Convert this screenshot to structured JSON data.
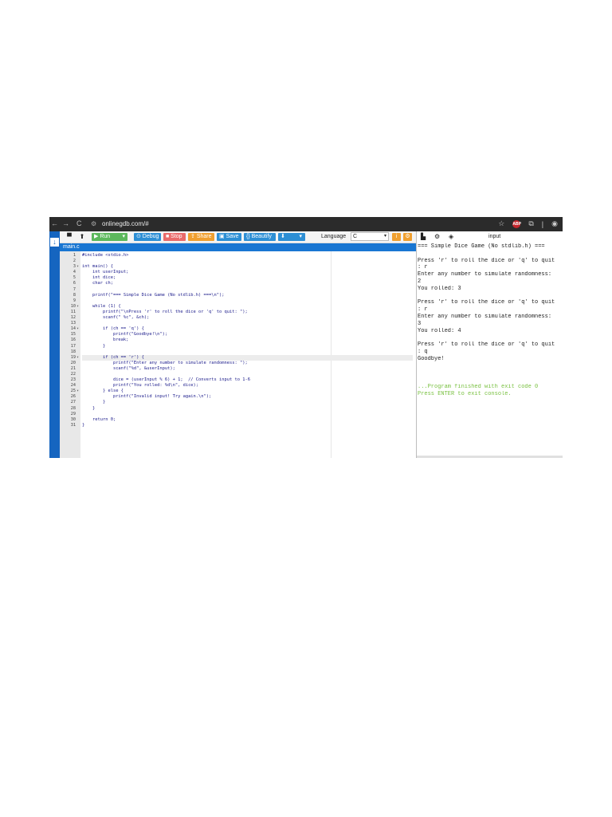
{
  "browser": {
    "url": "onlinegdb.com/#",
    "nav_back": "←",
    "nav_forward": "→",
    "reload": "C",
    "abp_label": "ABP"
  },
  "toolbar": {
    "run_label": "▶ Run",
    "debug_label": "⊙ Debug",
    "stop_label": "■ Stop",
    "share_label": "Share",
    "save_label": "Save",
    "beautify_label": "{} Beautify",
    "language_label": "Language",
    "language_value": "C",
    "colors": {
      "run": "#5cb85c",
      "debug": "#2d8fd5",
      "stop": "#e96a6a",
      "share": "#f0a030",
      "save": "#2d8fd5",
      "beautify": "#2d8fd5"
    }
  },
  "file_tab": {
    "name": "main.c"
  },
  "editor": {
    "lines": [
      {
        "n": "1",
        "text": "#include <stdio.h>"
      },
      {
        "n": "2",
        "text": ""
      },
      {
        "n": "3",
        "text": "int main() {"
      },
      {
        "n": "4",
        "text": "    int userInput;"
      },
      {
        "n": "5",
        "text": "    int dice;"
      },
      {
        "n": "6",
        "text": "    char ch;"
      },
      {
        "n": "7",
        "text": ""
      },
      {
        "n": "8",
        "text": "    printf(\"=== Simple Dice Game (No stdlib.h) ===\\n\");"
      },
      {
        "n": "9",
        "text": ""
      },
      {
        "n": "10",
        "text": "    while (1) {"
      },
      {
        "n": "11",
        "text": "        printf(\"\\nPress 'r' to roll the dice or 'q' to quit: \");"
      },
      {
        "n": "12",
        "text": "        scanf(\" %c\", &ch);"
      },
      {
        "n": "13",
        "text": ""
      },
      {
        "n": "14",
        "text": "        if (ch == 'q') {"
      },
      {
        "n": "15",
        "text": "            printf(\"Goodbye!\\n\");"
      },
      {
        "n": "16",
        "text": "            break;"
      },
      {
        "n": "17",
        "text": "        }"
      },
      {
        "n": "18",
        "text": ""
      },
      {
        "n": "19",
        "text": "        if (ch == 'r') {"
      },
      {
        "n": "20",
        "text": "            printf(\"Enter any number to simulate randomness: \");"
      },
      {
        "n": "21",
        "text": "            scanf(\"%d\", &userInput);"
      },
      {
        "n": "22",
        "text": ""
      },
      {
        "n": "23",
        "text": "            dice = (userInput % 6) + 1;  // Converts input to 1-6"
      },
      {
        "n": "24",
        "text": "            printf(\"You rolled: %d\\n\", dice);"
      },
      {
        "n": "25",
        "text": "        } else {"
      },
      {
        "n": "26",
        "text": "            printf(\"Invalid input! Try again.\\n\");"
      },
      {
        "n": "27",
        "text": "        }"
      },
      {
        "n": "28",
        "text": "    }"
      },
      {
        "n": "29",
        "text": ""
      },
      {
        "n": "30",
        "text": "    return 0;"
      },
      {
        "n": "31",
        "text": "}"
      }
    ],
    "fold_lines": [
      "3",
      "10",
      "14",
      "19",
      "25"
    ],
    "active_line": "19"
  },
  "output": {
    "title": "input",
    "lines": [
      "=== Simple Dice Game (No stdlib.h) ===",
      "",
      "Press 'r' to roll the dice or 'q' to quit",
      ": r",
      "Enter any number to simulate randomness:",
      "2",
      "You rolled: 3",
      "",
      "Press 'r' to roll the dice or 'q' to quit",
      ": r",
      "Enter any number to simulate randomness:",
      "3",
      "You rolled: 4",
      "",
      "Press 'r' to roll the dice or 'q' to quit",
      ": q",
      "Goodbye!",
      "",
      "",
      "",
      "...Program finished with exit code 0",
      "Press ENTER to exit console."
    ],
    "green_from_index": 20
  }
}
